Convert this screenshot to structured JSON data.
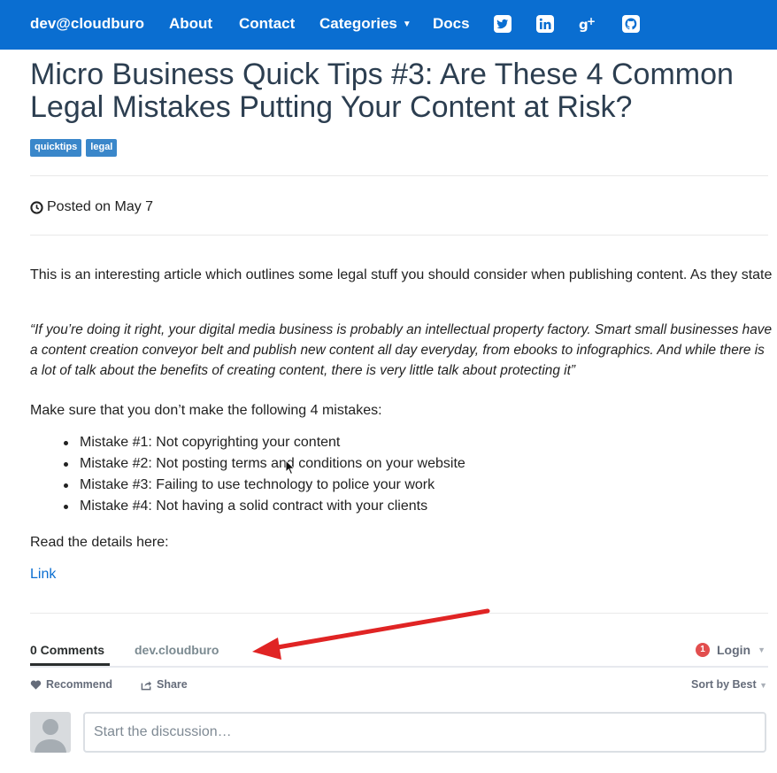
{
  "nav": {
    "brand": "dev@cloudburo",
    "items": [
      "About",
      "Contact",
      "Categories",
      "Docs"
    ],
    "social_icons": [
      "twitter-icon",
      "linkedin-icon",
      "google-plus-icon",
      "github-icon"
    ],
    "color": "#0a6ed1"
  },
  "article": {
    "title": "Micro Business Quick Tips #3: Are These 4 Common Legal Mistakes Putting Your Content at Risk?",
    "tags": [
      "quicktips",
      "legal"
    ],
    "posted": "Posted on May 7",
    "intro": "This is an interesting article which outlines some legal stuff you should consider when publishing content. As they state",
    "quote": "“If you’re doing it right, your digital media business is probably an intellectual property factory. Smart small businesses have a content creation conveyor belt and publish new content all day everyday, from ebooks to infographics. And while there is a lot of talk about the benefits of creating content, there is very little talk about protecting it”",
    "lead": "Make sure that you don’t make the following 4 mistakes:",
    "mistakes": [
      "Mistake #1: Not copyrighting your content",
      "Mistake #2: Not posting terms and conditions on your website",
      "Mistake #3: Failing to use technology to police your work",
      "Mistake #4: Not having a solid contract with your clients"
    ],
    "read_more": "Read the details here:",
    "link_text": "Link"
  },
  "comments": {
    "count_tab": "0 Comments",
    "site_tab": "dev.cloudburo",
    "notification_count": "1",
    "login": "Login",
    "recommend": "Recommend",
    "share": "Share",
    "sort": "Sort by Best",
    "placeholder": "Start the discussion…"
  }
}
